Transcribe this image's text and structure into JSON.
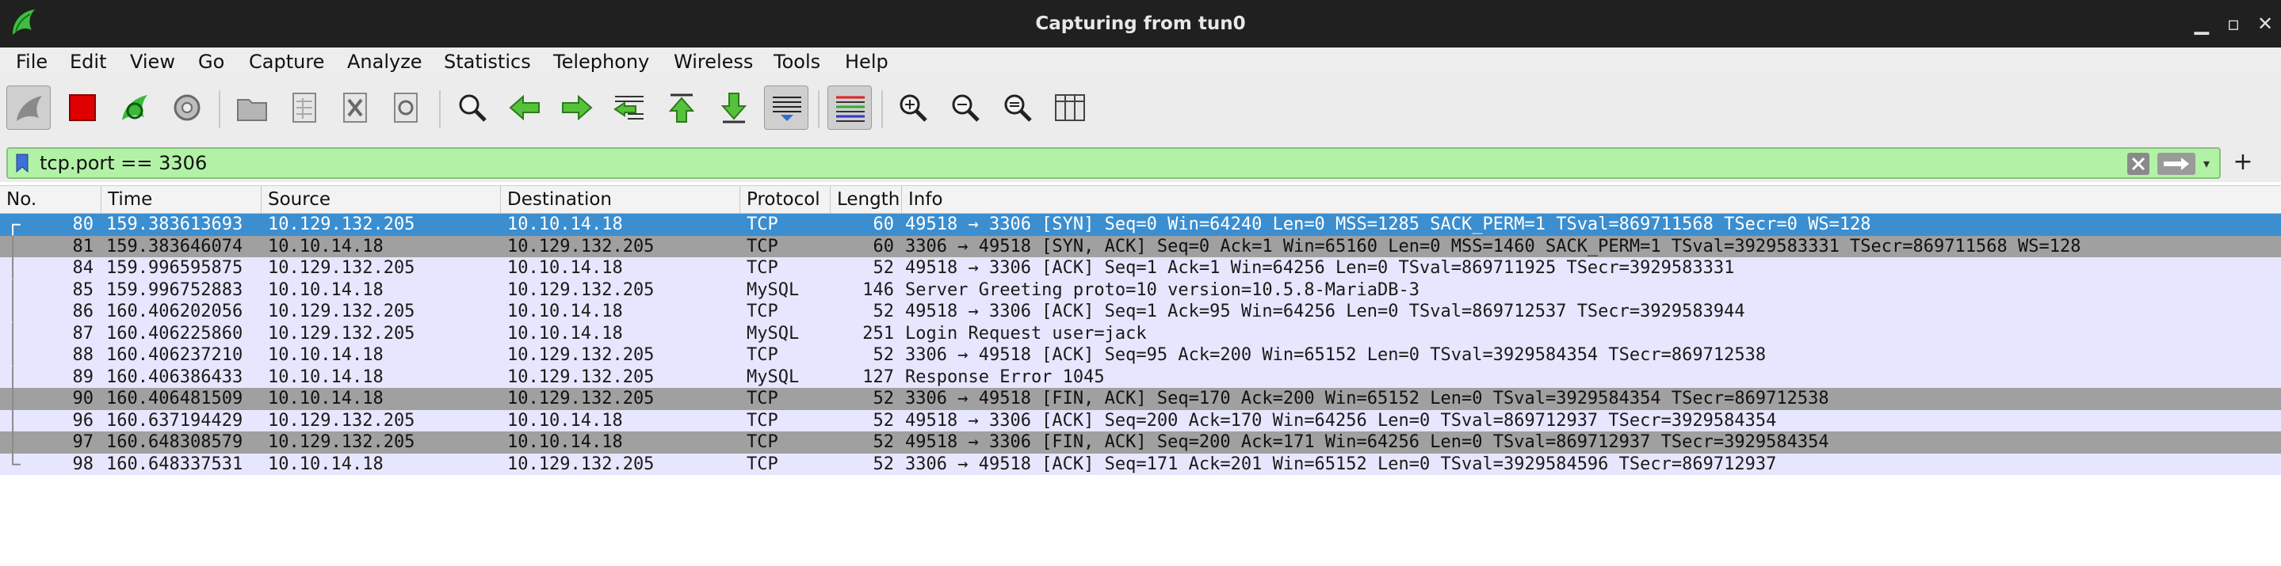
{
  "window": {
    "title": "Capturing from tun0"
  },
  "menu": [
    "File",
    "Edit",
    "View",
    "Go",
    "Capture",
    "Analyze",
    "Statistics",
    "Telephony",
    "Wireless",
    "Tools",
    "Help"
  ],
  "filter": {
    "value": "tcp.port == 3306"
  },
  "columns": [
    "No.",
    "Time",
    "Source",
    "Destination",
    "Protocol",
    "Length",
    "Info"
  ],
  "colors": {
    "selected": "#3b8ed0",
    "tcp_row": "#e7e6ff",
    "gray_row": "#a0a0a0",
    "filter_bg": "#b2f2a6"
  },
  "packets": [
    {
      "no": "80",
      "time": "159.383613693",
      "source": "10.129.132.205",
      "destination": "10.10.14.18",
      "protocol": "TCP",
      "length": "60",
      "info": "49518 → 3306 [SYN] Seq=0 Win=64240 Len=0 MSS=1285 SACK_PERM=1 TSval=869711568 TSecr=0 WS=128",
      "style": "selected"
    },
    {
      "no": "81",
      "time": "159.383646074",
      "source": "10.10.14.18",
      "destination": "10.129.132.205",
      "protocol": "TCP",
      "length": "60",
      "info": "3306 → 49518 [SYN, ACK] Seq=0 Ack=1 Win=65160 Len=0 MSS=1460 SACK_PERM=1 TSval=3929583331 TSecr=869711568 WS=128",
      "style": "gray"
    },
    {
      "no": "84",
      "time": "159.996595875",
      "source": "10.129.132.205",
      "destination": "10.10.14.18",
      "protocol": "TCP",
      "length": "52",
      "info": "49518 → 3306 [ACK] Seq=1 Ack=1 Win=64256 Len=0 TSval=869711925 TSecr=3929583331",
      "style": "normal"
    },
    {
      "no": "85",
      "time": "159.996752883",
      "source": "10.10.14.18",
      "destination": "10.129.132.205",
      "protocol": "MySQL",
      "length": "146",
      "info": "Server Greeting proto=10 version=10.5.8-MariaDB-3",
      "style": "normal"
    },
    {
      "no": "86",
      "time": "160.406202056",
      "source": "10.129.132.205",
      "destination": "10.10.14.18",
      "protocol": "TCP",
      "length": "52",
      "info": "49518 → 3306 [ACK] Seq=1 Ack=95 Win=64256 Len=0 TSval=869712537 TSecr=3929583944",
      "style": "normal"
    },
    {
      "no": "87",
      "time": "160.406225860",
      "source": "10.129.132.205",
      "destination": "10.10.14.18",
      "protocol": "MySQL",
      "length": "251",
      "info": "Login Request user=jack",
      "style": "normal"
    },
    {
      "no": "88",
      "time": "160.406237210",
      "source": "10.10.14.18",
      "destination": "10.129.132.205",
      "protocol": "TCP",
      "length": "52",
      "info": "3306 → 49518 [ACK] Seq=95 Ack=200 Win=65152 Len=0 TSval=3929584354 TSecr=869712538",
      "style": "normal"
    },
    {
      "no": "89",
      "time": "160.406386433",
      "source": "10.10.14.18",
      "destination": "10.129.132.205",
      "protocol": "MySQL",
      "length": "127",
      "info": "Response Error 1045",
      "style": "normal"
    },
    {
      "no": "90",
      "time": "160.406481509",
      "source": "10.10.14.18",
      "destination": "10.129.132.205",
      "protocol": "TCP",
      "length": "52",
      "info": "3306 → 49518 [FIN, ACK] Seq=170 Ack=200 Win=65152 Len=0 TSval=3929584354 TSecr=869712538",
      "style": "gray"
    },
    {
      "no": "96",
      "time": "160.637194429",
      "source": "10.129.132.205",
      "destination": "10.10.14.18",
      "protocol": "TCP",
      "length": "52",
      "info": "49518 → 3306 [ACK] Seq=200 Ack=170 Win=64256 Len=0 TSval=869712937 TSecr=3929584354",
      "style": "normal"
    },
    {
      "no": "97",
      "time": "160.648308579",
      "source": "10.129.132.205",
      "destination": "10.10.14.18",
      "protocol": "TCP",
      "length": "52",
      "info": "49518 → 3306 [FIN, ACK] Seq=200 Ack=171 Win=64256 Len=0 TSval=869712937 TSecr=3929584354",
      "style": "gray"
    },
    {
      "no": "98",
      "time": "160.648337531",
      "source": "10.10.14.18",
      "destination": "10.129.132.205",
      "protocol": "TCP",
      "length": "52",
      "info": "3306 → 49518 [ACK] Seq=171 Ack=201 Win=65152 Len=0 TSval=3929584596 TSecr=869712937",
      "style": "normal"
    }
  ]
}
